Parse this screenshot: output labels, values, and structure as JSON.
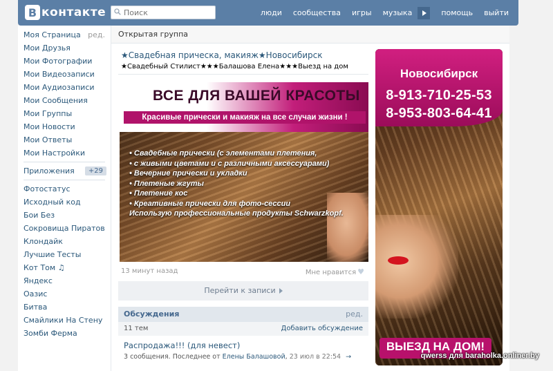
{
  "header": {
    "logo_text": "контакте",
    "logo_letter": "В",
    "search_placeholder": "Поиск",
    "nav": [
      "люди",
      "сообщества",
      "игры",
      "музыка",
      "помощь",
      "выйти"
    ]
  },
  "sidebar": {
    "items": [
      {
        "label": "Моя Страница",
        "extra": "ред."
      },
      {
        "label": "Мои Друзья"
      },
      {
        "label": "Мои Фотографии"
      },
      {
        "label": "Мои Видеозаписи"
      },
      {
        "label": "Мои Аудиозаписи"
      },
      {
        "label": "Мои Сообщения"
      },
      {
        "label": "Мои Группы"
      },
      {
        "label": "Мои Новости"
      },
      {
        "label": "Мои Ответы"
      },
      {
        "label": "Мои Настройки"
      }
    ],
    "apps": {
      "label": "Приложения",
      "count": "+29"
    },
    "app_items": [
      "Фотостатус",
      "Исходный код",
      "Бои Без",
      "Сокровища Пиратов",
      "Клондайк",
      "Лучшие Тесты",
      "Кот Том ♫",
      "Яндекс",
      "Оазис",
      "Битва",
      "Смайлики На Стену",
      "Зомби Ферма"
    ]
  },
  "main": {
    "page_title": "Открытая группа",
    "group_name": "★Свадебная прическа, макияж★Новосибирск",
    "group_status": "★Свадебный Стилист★★★Балашова Елена★★★Выезд на дом",
    "post": {
      "image": {
        "headline": "ВСЕ ДЛЯ ВАШЕЙ КРАСОТЫ",
        "subline": "Красивые прически и макияж на все случаи жизни !",
        "bullets": [
          "Свадебные прически (с элементами плетения,",
          "с живыми цветами и с различными аксессуарами)",
          "Вечерние прически и укладки",
          "Плетеные жгуты",
          "Плетение кос",
          "Креативные прически для фото-сессии"
        ],
        "products": "Использую профессиональные продукты Schwarzkopf."
      },
      "time": "13 минут назад",
      "like_label": "Мне нравится",
      "goto_label": "Перейти к записи"
    },
    "discussions": {
      "title": "Обсуждения",
      "edit": "ред.",
      "count": "11 тем",
      "add": "Добавить обсуждение",
      "topic_title": "Распродажа!!! (для невест)",
      "topic_prefix": "3 сообщения. Последнее от",
      "topic_author": "Елены Балашовой",
      "topic_date": "23 июл в 22:54",
      "topic_arrow": "→"
    }
  },
  "ad": {
    "city": "Новосибирск",
    "phone1": "8-913-710-25-53",
    "phone2": "8-953-803-64-41",
    "cta": "ВЫЕЗД НА ДОМ!"
  },
  "watermark": "qwerss для baraholka.onliner.by"
}
